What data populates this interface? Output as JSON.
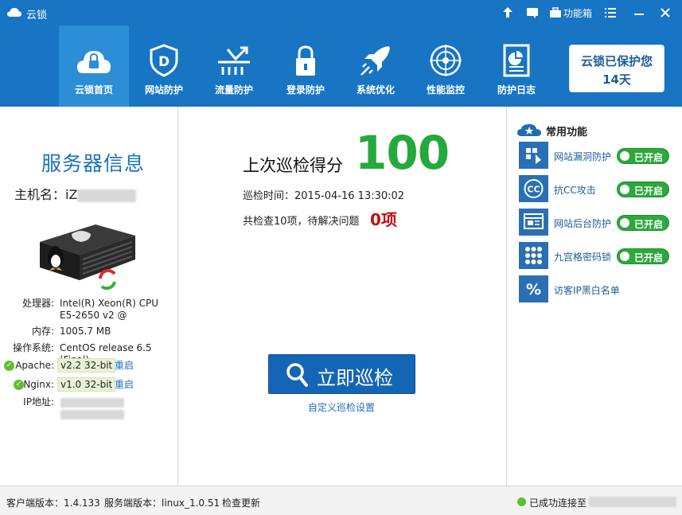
{
  "titlebar": {
    "title": "云锁",
    "toolbox_label": "功能箱",
    "icons": [
      "upload-icon",
      "message-icon",
      "toolbox-icon",
      "menu-icon",
      "minimize-icon",
      "close-icon"
    ]
  },
  "nav": {
    "items": [
      {
        "label": "云锁首页",
        "icon": "cloud-lock-icon",
        "active": true
      },
      {
        "label": "网站防护",
        "icon": "shield-d-icon",
        "active": false
      },
      {
        "label": "流量防护",
        "icon": "traffic-icon",
        "active": false
      },
      {
        "label": "登录防护",
        "icon": "padlock-icon",
        "active": false
      },
      {
        "label": "系统优化",
        "icon": "rocket-icon",
        "active": false
      },
      {
        "label": "性能监控",
        "icon": "radar-icon",
        "active": false
      },
      {
        "label": "防护日志",
        "icon": "report-icon",
        "active": false
      }
    ]
  },
  "protect": {
    "line1": "云锁已保护您",
    "line2": "14天"
  },
  "server": {
    "title": "服务器信息",
    "host_label": "主机名：iZ",
    "cpu_label": "处理器:",
    "cpu_value_1": "Intel(R) Xeon(R) CPU",
    "cpu_value_2": "E5-2650 v2 @",
    "mem_label": "内存:",
    "mem_value": "1005.7 MB",
    "os_label": "操作系统:",
    "os_value": "CentOS release 6.5 (Final)",
    "apache_label": "Apache:",
    "apache_value": "v2.2 32-bit",
    "nginx_label": "Nginx:",
    "nginx_value": "v1.0 32-bit",
    "restart_label": "重启",
    "ip_label": "IP地址:"
  },
  "scan": {
    "score_label": "上次巡检得分",
    "score": "100",
    "time": "巡检时间：2015-04-16 13:30:02",
    "summary": "共检查10项，待解决问题",
    "issues": "0项",
    "button_label": "立即巡检",
    "custom_link": "自定义巡检设置"
  },
  "features": {
    "title": "常用功能",
    "items": [
      {
        "label": "网站漏洞防护",
        "icon": "vuln-shield-icon",
        "status": "已开启"
      },
      {
        "label": "抗CC攻击",
        "icon": "cc-icon",
        "status": "已开启"
      },
      {
        "label": "网站后台防护",
        "icon": "backend-icon",
        "status": "已开启"
      },
      {
        "label": "九宫格密码锁",
        "icon": "grid-lock-icon",
        "status": "已开启"
      },
      {
        "label": "访客IP黑白名单",
        "icon": "ip-list-icon",
        "status": ""
      }
    ]
  },
  "statusbar": {
    "client_version": "客户端版本：1.4.133",
    "server_version": "服务端版本：linux_1.0.51",
    "update_link": "检查更新",
    "connected": "已成功连接至"
  },
  "colors": {
    "header_blue": "#1775c4",
    "accent_blue": "#1b6fc2",
    "score_green": "#24a93d",
    "toggle_green": "#2ca83c",
    "issue_red": "#c21010"
  }
}
